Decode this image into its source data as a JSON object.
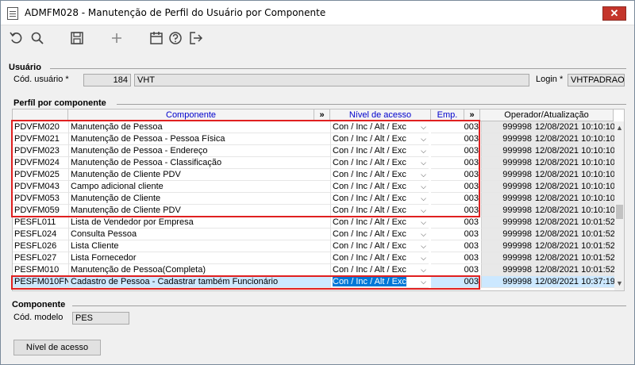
{
  "window": {
    "title": "ADMFM028 - Manutenção de Perfil do Usuário por Componente",
    "close_label": "✕"
  },
  "toolbar": {
    "icons": [
      "undo-icon",
      "search-icon",
      "save-icon",
      "add-icon",
      "calendar-icon",
      "help-icon",
      "exit-icon"
    ]
  },
  "usuario": {
    "section_title": "Usuário",
    "cod_label": "Cód. usuário *",
    "cod_value": "184",
    "name_value": "VHT",
    "login_label": "Login *",
    "login_value": "VHTPADRAO"
  },
  "perfil": {
    "section_title": "Perfíl por componente",
    "headers": {
      "componente": "Componente",
      "expand1": "»",
      "nivel": "Nível de acesso",
      "emp": "Emp.",
      "expand2": "»",
      "operador": "Operador/Atualização"
    },
    "rows": [
      {
        "code": "PDVFM020",
        "desc": "Manutenção de Pessoa",
        "nivel": "Con / Inc / Alt / Exc",
        "emp": "003",
        "op": "999998",
        "dt": "12/08/2021 10:10:10"
      },
      {
        "code": "PDVFM021",
        "desc": "Manutenção de Pessoa - Pessoa Física",
        "nivel": "Con / Inc / Alt / Exc",
        "emp": "003",
        "op": "999998",
        "dt": "12/08/2021 10:10:10"
      },
      {
        "code": "PDVFM023",
        "desc": "Manutenção de Pessoa - Endereço",
        "nivel": "Con / Inc / Alt / Exc",
        "emp": "003",
        "op": "999998",
        "dt": "12/08/2021 10:10:10"
      },
      {
        "code": "PDVFM024",
        "desc": "Manutenção de Pessoa - Classificação",
        "nivel": "Con / Inc / Alt / Exc",
        "emp": "003",
        "op": "999998",
        "dt": "12/08/2021 10:10:10"
      },
      {
        "code": "PDVFM025",
        "desc": "Manutenção de Cliente PDV",
        "nivel": "Con / Inc / Alt / Exc",
        "emp": "003",
        "op": "999998",
        "dt": "12/08/2021 10:10:10"
      },
      {
        "code": "PDVFM043",
        "desc": "Campo adicional cliente",
        "nivel": "Con / Inc / Alt / Exc",
        "emp": "003",
        "op": "999998",
        "dt": "12/08/2021 10:10:10"
      },
      {
        "code": "PDVFM053",
        "desc": "Manutenção de Cliente",
        "nivel": "Con / Inc / Alt / Exc",
        "emp": "003",
        "op": "999998",
        "dt": "12/08/2021 10:10:10"
      },
      {
        "code": "PDVFM059",
        "desc": "Manutenção de Cliente PDV",
        "nivel": "Con / Inc / Alt / Exc",
        "emp": "003",
        "op": "999998",
        "dt": "12/08/2021 10:10:10"
      },
      {
        "code": "PESFL011",
        "desc": "Lista de Vendedor por Empresa",
        "nivel": "Con / Inc / Alt / Exc",
        "emp": "003",
        "op": "999998",
        "dt": "12/08/2021 10:01:52"
      },
      {
        "code": "PESFL024",
        "desc": "Consulta Pessoa",
        "nivel": "Con / Inc / Alt / Exc",
        "emp": "003",
        "op": "999998",
        "dt": "12/08/2021 10:01:52"
      },
      {
        "code": "PESFL026",
        "desc": "Lista Cliente",
        "nivel": "Con / Inc / Alt / Exc",
        "emp": "003",
        "op": "999998",
        "dt": "12/08/2021 10:01:52"
      },
      {
        "code": "PESFL027",
        "desc": "Lista Fornecedor",
        "nivel": "Con / Inc / Alt / Exc",
        "emp": "003",
        "op": "999998",
        "dt": "12/08/2021 10:01:52"
      },
      {
        "code": "PESFM010",
        "desc": "Manutenção de Pessoa(Completa)",
        "nivel": "Con / Inc / Alt / Exc",
        "emp": "003",
        "op": "999998",
        "dt": "12/08/2021 10:01:52"
      },
      {
        "code": "PESFM010FN",
        "desc": "Cadastro de Pessoa - Cadastrar também Funcionário",
        "nivel": "Con / Inc / Alt / Exc",
        "emp": "003",
        "op": "999998",
        "dt": "12/08/2021 10:37:19"
      }
    ]
  },
  "componente": {
    "section_title": "Componente",
    "modelo_label": "Cód. modelo",
    "modelo_value": "PES"
  },
  "buttons": {
    "nivel_acesso": "Nível de acesso"
  }
}
